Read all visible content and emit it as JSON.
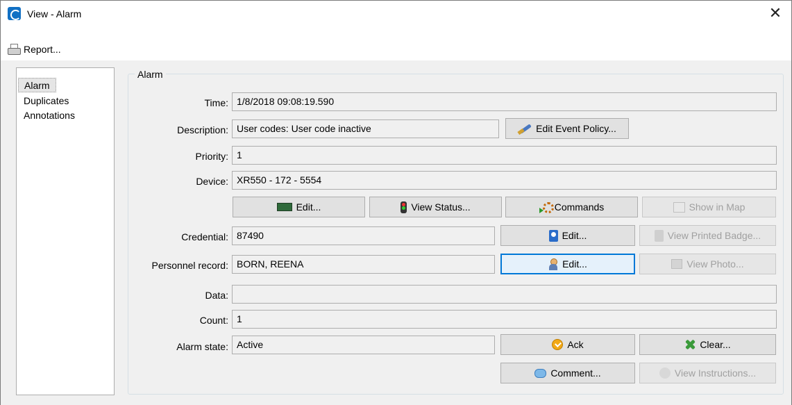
{
  "window": {
    "title": "View - Alarm",
    "close_glyph": "✕"
  },
  "menu": {
    "report_label": "Report..."
  },
  "nav": {
    "items": [
      "Alarm",
      "Duplicates",
      "Annotations"
    ],
    "selected": "Alarm"
  },
  "group": {
    "label": "Alarm"
  },
  "fields": {
    "time": {
      "label": "Time:",
      "value": "1/8/2018 09:08:19.590"
    },
    "description": {
      "label": "Description:",
      "value": "User codes: User code inactive"
    },
    "priority": {
      "label": "Priority:",
      "value": "1"
    },
    "device": {
      "label": "Device:",
      "value": "XR550 - 172 - 5554"
    },
    "credential": {
      "label": "Credential:",
      "value": "87490"
    },
    "personnel": {
      "label": "Personnel record:",
      "value": "BORN, REENA"
    },
    "data": {
      "label": "Data:",
      "value": ""
    },
    "count": {
      "label": "Count:",
      "value": "1"
    },
    "alarm_state": {
      "label": "Alarm state:",
      "value": "Active"
    }
  },
  "buttons": {
    "edit_event_policy": "Edit Event Policy...",
    "device_edit": "Edit...",
    "view_status": "View Status...",
    "commands": "Commands",
    "show_in_map": "Show in Map",
    "credential_edit": "Edit...",
    "view_printed_badge": "View Printed Badge...",
    "personnel_edit": "Edit...",
    "view_photo": "View Photo...",
    "ack": "Ack",
    "clear": "Clear...",
    "comment": "Comment...",
    "view_instructions": "View Instructions..."
  },
  "icons": {
    "app": "app-logo-icon",
    "report": "printer-icon",
    "edit_event_policy": "pen-icon",
    "device_edit": "circuit-board-icon",
    "view_status": "traffic-light-icon",
    "commands": "gear-icon",
    "show_in_map": "map-icon",
    "credential_edit": "badge-icon",
    "view_printed_badge": "badge-icon",
    "personnel_edit": "person-icon",
    "view_photo": "photo-icon",
    "ack": "checkmark-icon",
    "clear": "x-icon",
    "comment": "speech-bubble-icon",
    "view_instructions": "instructions-icon"
  },
  "colors": {
    "focus": "#0078d7",
    "app_icon": "#1170c4"
  }
}
